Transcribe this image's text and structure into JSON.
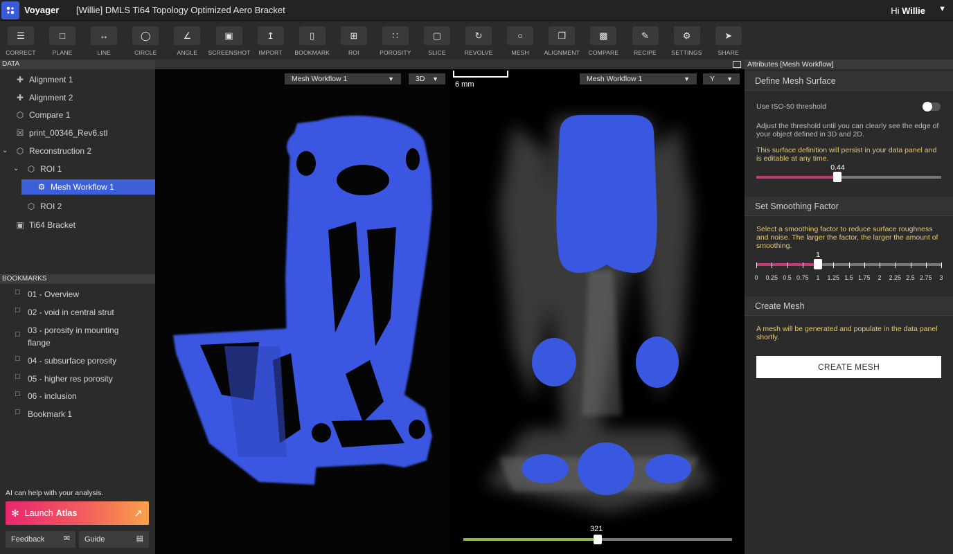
{
  "header": {
    "app_name": "Voyager",
    "doc_title": "[Willie] DMLS Ti64 Topology Optimized Aero Bracket",
    "greeting": "Hi",
    "user_name": "Willie"
  },
  "toolbar": [
    {
      "label": "CORRECT",
      "icon": "sliders-icon"
    },
    {
      "label": "PLANE",
      "icon": "square-icon"
    },
    {
      "label": "LINE",
      "icon": "line-icon"
    },
    {
      "label": "CIRCLE",
      "icon": "circle-icon"
    },
    {
      "label": "ANGLE",
      "icon": "angle-icon"
    },
    {
      "label": "SCREENSHOT",
      "icon": "screenshot-icon"
    },
    {
      "label": "IMPORT",
      "icon": "import-icon"
    },
    {
      "label": "BOOKMARK",
      "icon": "bookmark-icon"
    },
    {
      "label": "ROI",
      "icon": "crop-icon"
    },
    {
      "label": "POROSITY",
      "icon": "porosity-icon"
    },
    {
      "label": "SLICE",
      "icon": "slice-icon"
    },
    {
      "label": "REVOLVE",
      "icon": "revolve-icon"
    },
    {
      "label": "MESH",
      "icon": "mesh-icon"
    },
    {
      "label": "ALIGNMENT",
      "icon": "alignment-icon"
    },
    {
      "label": "COMPARE",
      "icon": "compare-icon"
    },
    {
      "label": "RECIPE",
      "icon": "recipe-icon"
    },
    {
      "label": "SETTINGS",
      "icon": "gear-icon"
    },
    {
      "label": "SHARE",
      "icon": "share-icon"
    }
  ],
  "data_panel": {
    "title": "DATA",
    "items": [
      {
        "label": "Alignment 1",
        "icon": "alignment-icon"
      },
      {
        "label": "Alignment 2",
        "icon": "alignment-icon"
      },
      {
        "label": "Compare 1",
        "icon": "cube-icon"
      },
      {
        "label": "print_00346_Rev6.stl",
        "icon": "stl-file-icon"
      },
      {
        "label": "Reconstruction 2",
        "icon": "cube-icon"
      },
      {
        "label": "ROI 1",
        "icon": "cube-icon"
      },
      {
        "label": "Mesh Workflow 1",
        "icon": "mesh-workflow-icon"
      },
      {
        "label": "ROI 2",
        "icon": "cube-icon"
      },
      {
        "label": "Ti64 Bracket",
        "icon": "volume-icon"
      }
    ]
  },
  "bookmarks_panel": {
    "title": "BOOKMARKS",
    "items": [
      {
        "label": "01 - Overview"
      },
      {
        "label": "02 - void in central strut"
      },
      {
        "label": "03 - porosity in mounting flange"
      },
      {
        "label": "04 - subsurface porosity"
      },
      {
        "label": "05 - higher res porosity"
      },
      {
        "label": "06 - inclusion"
      },
      {
        "label": "Bookmark 1"
      }
    ]
  },
  "assistant": {
    "hint": "AI can help with your analysis.",
    "launch_prefix": "Launch",
    "launch_name": "Atlas",
    "feedback_label": "Feedback",
    "guide_label": "Guide"
  },
  "viewports": {
    "left_dataset": "Mesh Workflow 1",
    "left_mode": "3D",
    "right_dataset": "Mesh Workflow 1",
    "right_axis": "Y",
    "scale_label": "6 mm",
    "slice_value": "321",
    "slice_fraction": 0.5
  },
  "attributes": {
    "header": "Attributes [Mesh Workflow]",
    "surface_title": "Define Mesh Surface",
    "iso_label": "Use ISO-50 threshold",
    "iso_enabled": false,
    "surface_help": "Adjust the threshold until you can clearly see the edge of your object defined in 3D and 2D.",
    "surface_note": "This surface definition will persist in your data panel and is editable at any time.",
    "threshold_value": "0.44",
    "threshold_fraction": 0.44,
    "smoothing_title": "Set Smoothing Factor",
    "smoothing_help": "Select a smoothing factor to reduce surface roughness and noise. The larger the factor, the larger the amount of smoothing.",
    "smoothing_value": "1",
    "smoothing_ticks": [
      "0",
      "0.25",
      "0.5",
      "0.75",
      "1",
      "1.25",
      "1.5",
      "1.75",
      "2",
      "2.25",
      "2.5",
      "2.75",
      "3"
    ],
    "mesh_title": "Create Mesh",
    "mesh_note": "A mesh will be generated and populate in the data panel shortly.",
    "create_label": "CREATE MESH"
  },
  "colors": {
    "accent": "#3d5fd8",
    "mesh_blue": "#3f5fe8",
    "slider_magenta": "#c23a78",
    "slice_green": "#8db34f",
    "note_yellow": "#e8c86a"
  }
}
